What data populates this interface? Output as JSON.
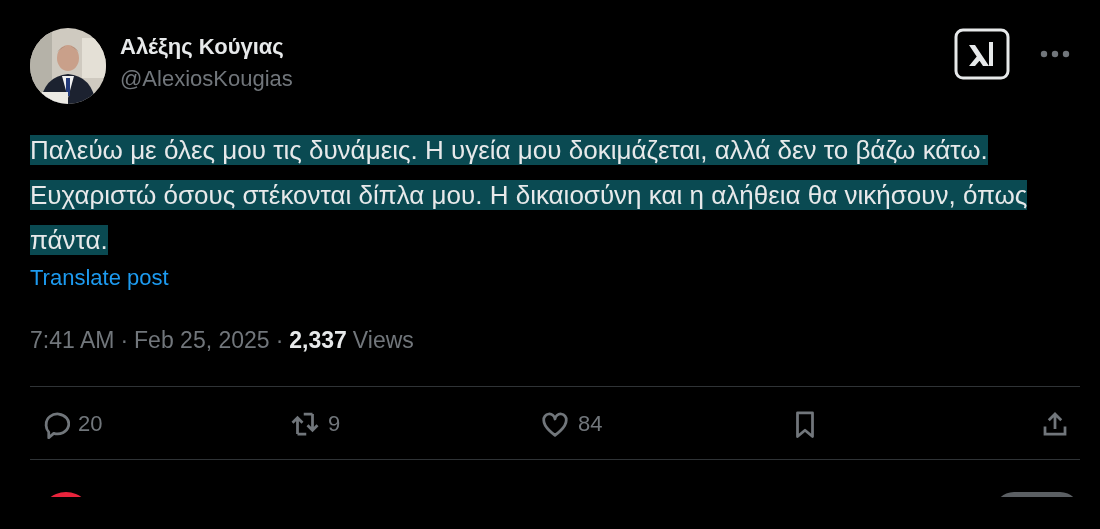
{
  "author": {
    "name": "Αλέξης Κούγιας",
    "handle": "@AlexiosKougias"
  },
  "post": {
    "text": "Παλεύω με όλες μου τις δυνάμεις. Η υγεία μου δοκιμάζεται, αλλά δεν το βάζω κάτω. Ευχαριστώ όσους στέκονται δίπλα μου. Η δικαιοσύνη και η αλήθεια θα νικήσουν, όπως πάντα.",
    "highlighted": true,
    "translate_link": "Translate post"
  },
  "meta": {
    "time": "7:41 AM",
    "separator_1": "·",
    "date": "Feb 25, 2025",
    "separator_2": "·",
    "views_count": "2,337",
    "views_label": "Views"
  },
  "actions": [
    {
      "kind": "reply",
      "count": "20"
    },
    {
      "kind": "repost",
      "count": "9"
    },
    {
      "kind": "like",
      "count": "84"
    },
    {
      "kind": "bookmark"
    },
    {
      "kind": "share"
    }
  ]
}
